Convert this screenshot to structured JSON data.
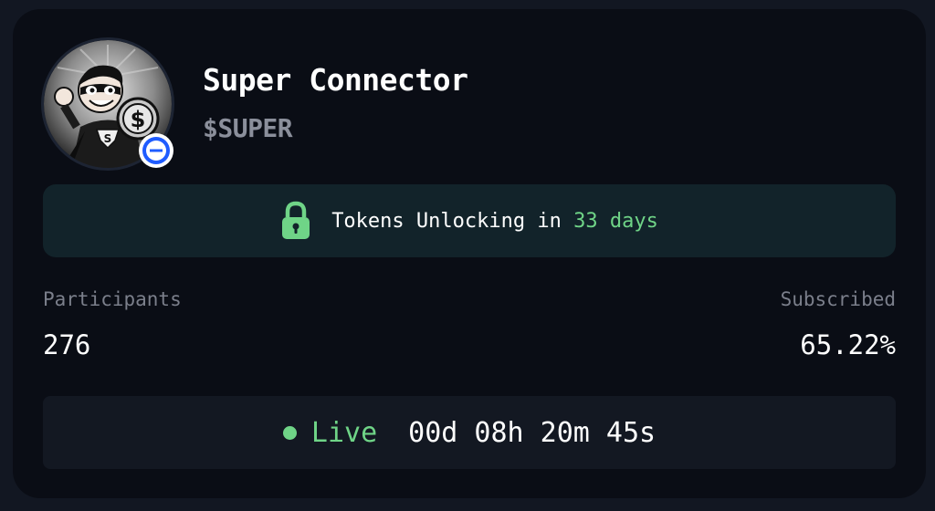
{
  "token": {
    "name": "Super Connector",
    "symbol": "$SUPER",
    "avatar_icon": "superhero-coin-mascot-avatar",
    "chain_badge_icon": "base-chain-icon"
  },
  "unlock": {
    "icon": "lock-icon",
    "prefix": "Tokens Unlocking in ",
    "days": "33 days"
  },
  "stats": {
    "participants_label": "Participants",
    "participants_value": "276",
    "subscribed_label": "Subscribed",
    "subscribed_value": "65.22%"
  },
  "status": {
    "label": "Live",
    "countdown": "00d 08h 20m 45s"
  },
  "colors": {
    "accent_green": "#6fd487",
    "card_bg": "#0a0d15",
    "page_bg": "#121722",
    "banner_bg": "#12232a",
    "badge_blue": "#1f5cff"
  }
}
